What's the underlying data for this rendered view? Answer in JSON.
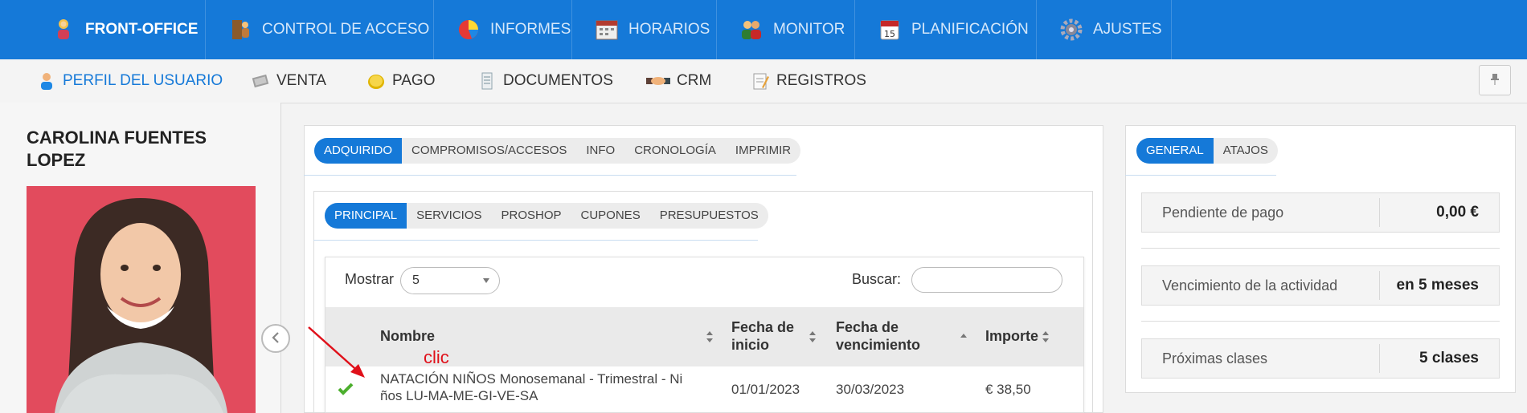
{
  "top_nav": {
    "items": [
      {
        "label": "FRONT-OFFICE",
        "icon": "person-icon",
        "active": true
      },
      {
        "label": "CONTROL DE ACCESO",
        "icon": "door-icon"
      },
      {
        "label": "INFORMES",
        "icon": "pie-chart-icon"
      },
      {
        "label": "HORARIOS",
        "icon": "calendar-icon"
      },
      {
        "label": "MONITOR",
        "icon": "people-icon"
      },
      {
        "label": "PLANIFICACIÓN",
        "icon": "date-icon"
      },
      {
        "label": "AJUSTES",
        "icon": "gear-icon"
      }
    ]
  },
  "sub_nav": {
    "items": [
      {
        "label": "PERFIL DEL USUARIO",
        "icon": "user-icon",
        "active": true
      },
      {
        "label": "VENTA",
        "icon": "cash-icon"
      },
      {
        "label": "PAGO",
        "icon": "coin-icon"
      },
      {
        "label": "DOCUMENTOS",
        "icon": "document-icon"
      },
      {
        "label": "CRM",
        "icon": "handshake-icon"
      },
      {
        "label": "REGISTROS",
        "icon": "notepad-icon"
      }
    ],
    "pin_icon": "pin-icon"
  },
  "profile": {
    "name": "CAROLINA FUENTES LOPEZ"
  },
  "main": {
    "tabs": [
      "ADQUIRIDO",
      "COMPROMISOS/ACCESOS",
      "INFO",
      "CRONOLOGÍA",
      "IMPRIMIR"
    ],
    "subtabs": [
      "PRINCIPAL",
      "SERVICIOS",
      "PROSHOP",
      "CUPONES",
      "PRESUPUESTOS"
    ],
    "show_label": "Mostrar",
    "show_value": "5",
    "search_label": "Buscar:",
    "search_value": "",
    "columns": [
      "Nombre",
      "Fecha de inicio",
      "Fecha de vencimiento",
      "Importe"
    ],
    "rows": [
      {
        "status": "check-icon",
        "name_line1": "NATACIÓN NIÑOS Monosemanal - Trimestral - Ni",
        "name_line2": "ños LU-MA-ME-GI-VE-SA",
        "start": "01/01/2023",
        "end": "30/03/2023",
        "amount": "€ 38,50"
      }
    ],
    "annotation": "clic"
  },
  "side": {
    "tabs": [
      "GENERAL",
      "ATAJOS"
    ],
    "rows": [
      {
        "label": "Pendiente de pago",
        "value": "0,00 €"
      },
      {
        "label": "Vencimiento de la actividad",
        "value": "en 5 meses"
      },
      {
        "label": "Próximas clases",
        "value": "5 clases"
      }
    ]
  },
  "colors": {
    "primary": "#1579d8",
    "annotation": "#e0101a",
    "check": "#4caf2e"
  }
}
